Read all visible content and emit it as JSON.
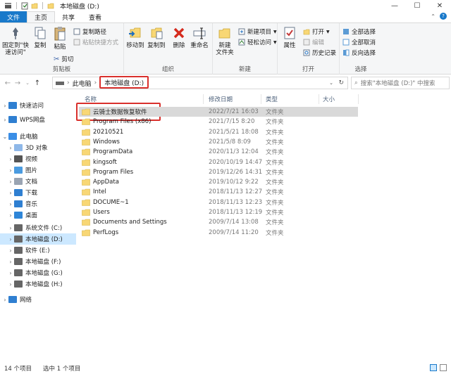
{
  "window": {
    "title": "本地磁盘 (D:)"
  },
  "tabs": [
    "文件",
    "主页",
    "共享",
    "查看"
  ],
  "ribbon": {
    "clipboard": {
      "label": "剪贴板",
      "pin": "固定到\"快\n速访问\"",
      "copy": "复制",
      "paste": "粘贴",
      "copy_path": "复制路径",
      "paste_shortcut": "粘贴快捷方式",
      "cut": "剪切"
    },
    "organize": {
      "label": "组织",
      "move_to": "移动到",
      "copy_to": "复制到",
      "delete": "删除",
      "rename": "重命名"
    },
    "new": {
      "label": "新建",
      "new_folder": "新建\n文件夹",
      "new_item": "新建项目",
      "easy_access": "轻松访问"
    },
    "open": {
      "label": "打开",
      "properties": "属性",
      "open": "打开",
      "edit": "编辑",
      "history": "历史记录"
    },
    "select": {
      "label": "选择",
      "select_all": "全部选择",
      "select_none": "全部取消",
      "invert": "反向选择"
    }
  },
  "address": {
    "crumbs": [
      "此电脑",
      "本地磁盘 (D:)"
    ],
    "search_placeholder": "搜索\"本地磁盘 (D:)\" 中搜索"
  },
  "nav": [
    {
      "label": "快速访问",
      "icon": "star-icon",
      "indent": 0,
      "expand": true
    },
    {
      "label": "WPS网盘",
      "icon": "cloud-icon",
      "indent": 0,
      "expand": true
    },
    {
      "label": "此电脑",
      "icon": "computer-icon",
      "indent": 0,
      "expand": true,
      "open": true
    },
    {
      "label": "3D 对象",
      "icon": "cube-icon",
      "indent": 1,
      "expand": true
    },
    {
      "label": "视频",
      "icon": "video-icon",
      "indent": 1,
      "expand": true
    },
    {
      "label": "图片",
      "icon": "picture-icon",
      "indent": 1,
      "expand": true
    },
    {
      "label": "文档",
      "icon": "document-icon",
      "indent": 1,
      "expand": true
    },
    {
      "label": "下载",
      "icon": "download-icon",
      "indent": 1,
      "expand": true
    },
    {
      "label": "音乐",
      "icon": "music-icon",
      "indent": 1,
      "expand": true
    },
    {
      "label": "桌面",
      "icon": "desktop-icon",
      "indent": 1,
      "expand": true
    },
    {
      "label": "系统文件 (C:)",
      "icon": "drive-icon",
      "indent": 1,
      "expand": true
    },
    {
      "label": "本地磁盘 (D:)",
      "icon": "drive-icon",
      "indent": 1,
      "expand": true,
      "selected": true
    },
    {
      "label": "软件 (E:)",
      "icon": "drive-icon",
      "indent": 1,
      "expand": true
    },
    {
      "label": "本地磁盘 (F:)",
      "icon": "drive-icon",
      "indent": 1,
      "expand": true
    },
    {
      "label": "本地磁盘 (G:)",
      "icon": "drive-icon",
      "indent": 1,
      "expand": true
    },
    {
      "label": "本地磁盘 (H:)",
      "icon": "drive-icon",
      "indent": 1,
      "expand": true
    },
    {
      "label": "网络",
      "icon": "network-icon",
      "indent": 0,
      "expand": true
    }
  ],
  "columns": {
    "name": "名称",
    "date": "修改日期",
    "type": "类型",
    "size": "大小"
  },
  "files": [
    {
      "name": "云骑士数据恢复软件",
      "date": "2022/7/21 16:03",
      "type": "文件夹",
      "selected": true
    },
    {
      "name": "Program Files (x86)",
      "date": "2021/7/15 8:20",
      "type": "文件夹"
    },
    {
      "name": "20210521",
      "date": "2021/5/21 18:08",
      "type": "文件夹"
    },
    {
      "name": "Windows",
      "date": "2021/5/8 8:09",
      "type": "文件夹"
    },
    {
      "name": "ProgramData",
      "date": "2020/11/3 12:04",
      "type": "文件夹"
    },
    {
      "name": "kingsoft",
      "date": "2020/10/19 14:47",
      "type": "文件夹"
    },
    {
      "name": "Program Files",
      "date": "2019/12/26 14:31",
      "type": "文件夹"
    },
    {
      "name": "AppData",
      "date": "2019/10/12 9:22",
      "type": "文件夹"
    },
    {
      "name": "Intel",
      "date": "2018/11/13 12:27",
      "type": "文件夹"
    },
    {
      "name": "DOCUME~1",
      "date": "2018/11/13 12:23",
      "type": "文件夹"
    },
    {
      "name": "Users",
      "date": "2018/11/13 12:19",
      "type": "文件夹"
    },
    {
      "name": "Documents and Settings",
      "date": "2009/7/14 13:08",
      "type": "文件夹"
    },
    {
      "name": "PerfLogs",
      "date": "2009/7/14 11:20",
      "type": "文件夹"
    }
  ],
  "status": {
    "count": "14 个项目",
    "selection": "选中 1 个项目"
  },
  "colors": {
    "accent": "#1979ca",
    "highlight": "#d9302c",
    "folder": "#f8d775"
  }
}
